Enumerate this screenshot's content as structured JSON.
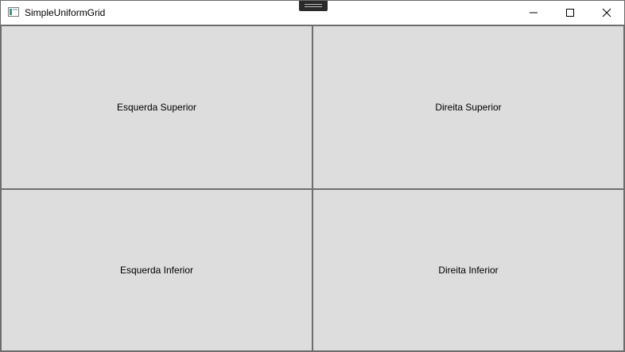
{
  "window": {
    "title": "SimpleUniformGrid",
    "icon": "app-window-icon",
    "controls": {
      "minimize_icon": "minimize-icon",
      "maximize_icon": "maximize-icon",
      "close_icon": "close-icon"
    }
  },
  "grid": {
    "cells": [
      {
        "label": "Esquerda Superior"
      },
      {
        "label": "Direita Superior"
      },
      {
        "label": "Esquerda Inferior"
      },
      {
        "label": "Direita Inferior"
      }
    ]
  },
  "colors": {
    "cell_background": "#dddddd",
    "grid_line": "#6e6e6e",
    "titlebar": "#ffffff"
  }
}
